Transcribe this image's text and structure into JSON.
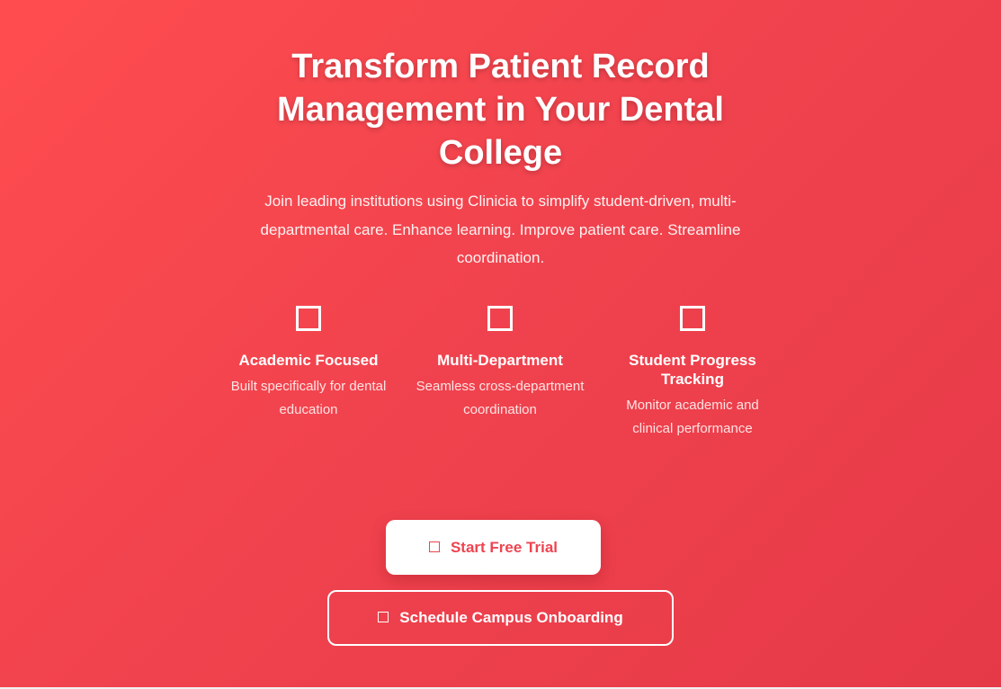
{
  "hero": {
    "headline": "Transform Patient Record Management in Your Dental College",
    "subtext": "Join leading institutions using Clinicia to simplify student-driven, multi-departmental care. Enhance learning. Improve patient care. Streamline coordination."
  },
  "features": [
    {
      "icon": "square-outline-icon",
      "title": "Academic Focused",
      "description": "Built specifically for dental education"
    },
    {
      "icon": "square-outline-icon",
      "title": "Multi-Department",
      "description": "Seamless cross-department coordination"
    },
    {
      "icon": "square-outline-icon",
      "title": "Student Progress Tracking",
      "description": "Monitor academic and clinical performance"
    }
  ],
  "cta": {
    "primary_label": "Start Free Trial",
    "secondary_label": "Schedule Campus Onboarding"
  },
  "colors": {
    "background_start": "#ff4d4f",
    "background_end": "#e63948",
    "primary_button_bg": "#ffffff",
    "primary_button_text": "#ee4450",
    "text": "#ffffff"
  }
}
